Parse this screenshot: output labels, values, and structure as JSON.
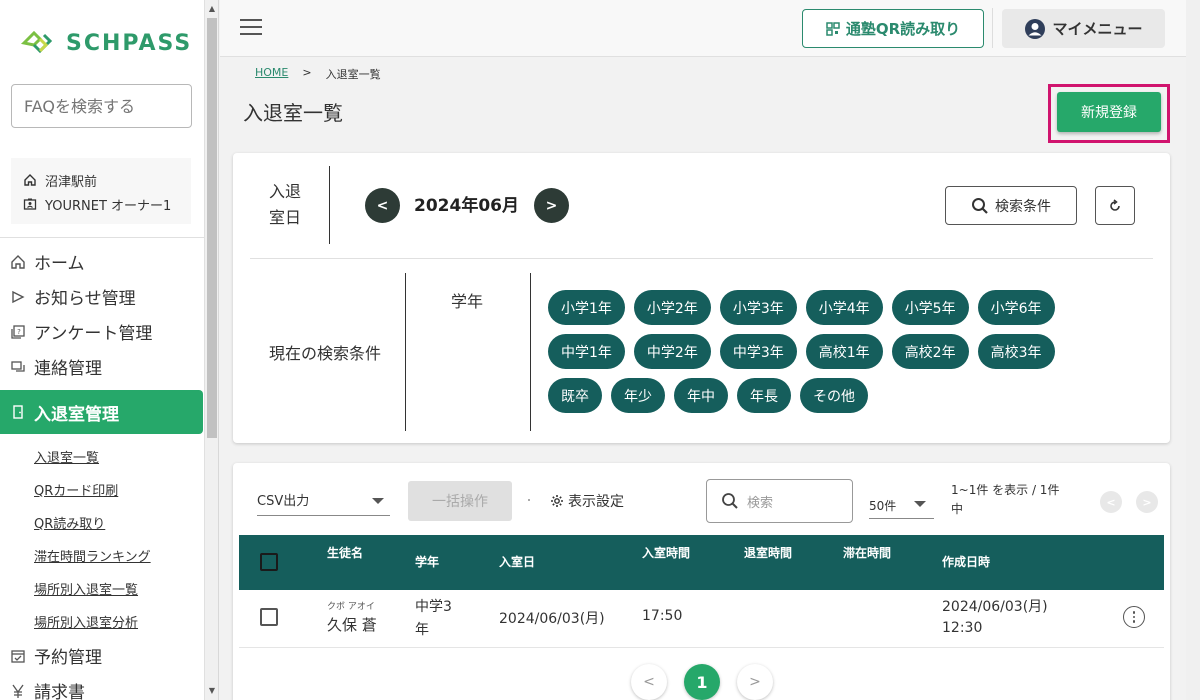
{
  "logo": {
    "text": "SCHPASS",
    "color": "#2e9a6a"
  },
  "sidebar": {
    "faq_placeholder": "FAQを検索する",
    "school": "沼津駅前",
    "user": "YOURNET オーナー1",
    "nav": {
      "home": "ホーム",
      "notice": "お知らせ管理",
      "survey": "アンケート管理",
      "contact": "連絡管理",
      "attendance": "入退室管理",
      "reservation": "予約管理",
      "invoice": "請求書"
    },
    "sub": [
      "入退室一覧",
      "QRカード印刷",
      "QR読み取り",
      "滞在時間ランキング",
      "場所別入退室一覧",
      "場所別入退室分析"
    ]
  },
  "header": {
    "qr_label": "通塾QR読み取り",
    "mymenu_label": "マイメニュー"
  },
  "breadcrumb": {
    "home": "HOME",
    "sep": ">",
    "current": "入退室一覧"
  },
  "page": {
    "title": "入退室一覧",
    "new_button": "新規登録",
    "accent": "#26a86a",
    "highlight": "#d0146e"
  },
  "search": {
    "date_label": "入退室日",
    "month": "2024年06月",
    "condition_button": "検索条件",
    "current_label": "現在の検索条件",
    "grade_label": "学年",
    "grades": [
      "小学1年",
      "小学2年",
      "小学3年",
      "小学4年",
      "小学5年",
      "小学6年",
      "中学1年",
      "中学2年",
      "中学3年",
      "高校1年",
      "高校2年",
      "高校3年",
      "既卒",
      "年少",
      "年中",
      "年長",
      "その他"
    ]
  },
  "table": {
    "csv_label": "CSV出力",
    "bulk_label": "一括操作",
    "display_settings": "表示設定",
    "search_placeholder": "検索",
    "per_page": "50件",
    "range_text": "1~1件 を表示 / 1件中",
    "columns": {
      "name": "生徒名",
      "grade": "学年",
      "date": "入室日",
      "in": "入室時間",
      "out": "退室時間",
      "stay": "滞在時間",
      "created": "作成日時"
    },
    "rows": [
      {
        "kana": "クボ アオイ",
        "name": "久保 蒼",
        "grade": "中学3年",
        "date": "2024/06/03(月)",
        "in": "17:50",
        "out": "",
        "stay": "",
        "created_date": "2024/06/03(月)",
        "created_time": "12:30"
      }
    ],
    "current_page": "1",
    "header_color": "#155e5c"
  }
}
